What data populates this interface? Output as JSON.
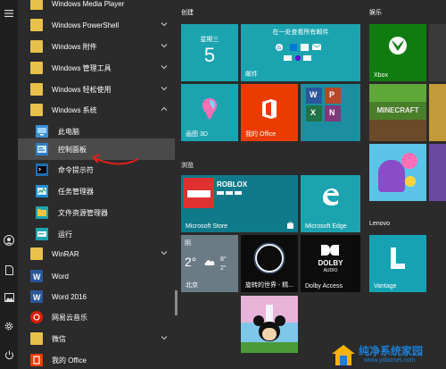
{
  "left_rail": {
    "icons": [
      "menu-icon",
      "user-icon",
      "document-icon",
      "pictures-icon",
      "settings-icon",
      "power-icon"
    ]
  },
  "app_list": [
    {
      "label": "Windows Media Player",
      "icon": "media-player-icon",
      "indent": false,
      "chevron": false
    },
    {
      "label": "Windows PowerShell",
      "icon": "folder-icon",
      "indent": false,
      "chevron": true
    },
    {
      "label": "Windows 附件",
      "icon": "folder-icon",
      "indent": false,
      "chevron": true
    },
    {
      "label": "Windows 管理工具",
      "icon": "folder-icon",
      "indent": false,
      "chevron": true
    },
    {
      "label": "Windows 轻松使用",
      "icon": "folder-icon",
      "indent": false,
      "chevron": true
    },
    {
      "label": "Windows 系统",
      "icon": "folder-icon",
      "indent": false,
      "chevron": true,
      "expanded": true
    },
    {
      "label": "此电脑",
      "icon": "computer-icon",
      "indent": true
    },
    {
      "label": "控制面板",
      "icon": "control-panel-icon",
      "indent": true,
      "selected": true
    },
    {
      "label": "命令提示符",
      "icon": "cmd-icon",
      "indent": true
    },
    {
      "label": "任务管理器",
      "icon": "task-manager-icon",
      "indent": true
    },
    {
      "label": "文件资源管理器",
      "icon": "file-explorer-icon",
      "indent": true
    },
    {
      "label": "运行",
      "icon": "run-icon",
      "indent": true
    },
    {
      "label": "WinRAR",
      "icon": "folder-icon",
      "indent": false,
      "chevron": true
    },
    {
      "label": "Word",
      "icon": "word-icon",
      "indent": false
    },
    {
      "label": "Word 2016",
      "icon": "word-icon",
      "indent": false
    },
    {
      "label": "网易云音乐",
      "icon": "netease-music-icon",
      "indent": false
    },
    {
      "label": "微信",
      "icon": "folder-icon",
      "indent": false,
      "chevron": true
    },
    {
      "label": "我的 Office",
      "icon": "office-icon",
      "indent": false
    }
  ],
  "groups": {
    "create": "创建",
    "entertainment": "娱乐",
    "browse": "浏览",
    "lenovo": "Lenovo"
  },
  "tiles": {
    "calendar": {
      "weekday": "星期三",
      "day": "5"
    },
    "mail": {
      "header": "在一处查看所有邮件",
      "name": "邮件"
    },
    "paint3d": {
      "name": "画图 3D"
    },
    "office": {
      "name": "我的 Office"
    },
    "xbox": {
      "name": "Xbox"
    },
    "minecraft": {
      "name": "MINECRAFT"
    },
    "store": {
      "title": "ROBLOX",
      "name": "Microsoft Store"
    },
    "edge": {
      "name": "Microsoft Edge"
    },
    "weather": {
      "condition": "阴",
      "temp": "2°",
      "high": "8°",
      "low": "2°",
      "city": "北京"
    },
    "eclipse": {
      "name": "旋转的世界 - 精..."
    },
    "dolby": {
      "brand": "DOLBY",
      "sub": "AUDIO",
      "name": "Dolby Access"
    },
    "vantage": {
      "name": "Vantage"
    }
  },
  "watermark": {
    "text": "纯净系统家园",
    "url": "www.yidaimei.com"
  },
  "colors": {
    "tile_teal": "#1ba4b0",
    "office_orange": "#eb3c00",
    "xbox_green": "#107c10",
    "accent_red": "#e81123",
    "folder_yellow": "#e8c14a"
  }
}
